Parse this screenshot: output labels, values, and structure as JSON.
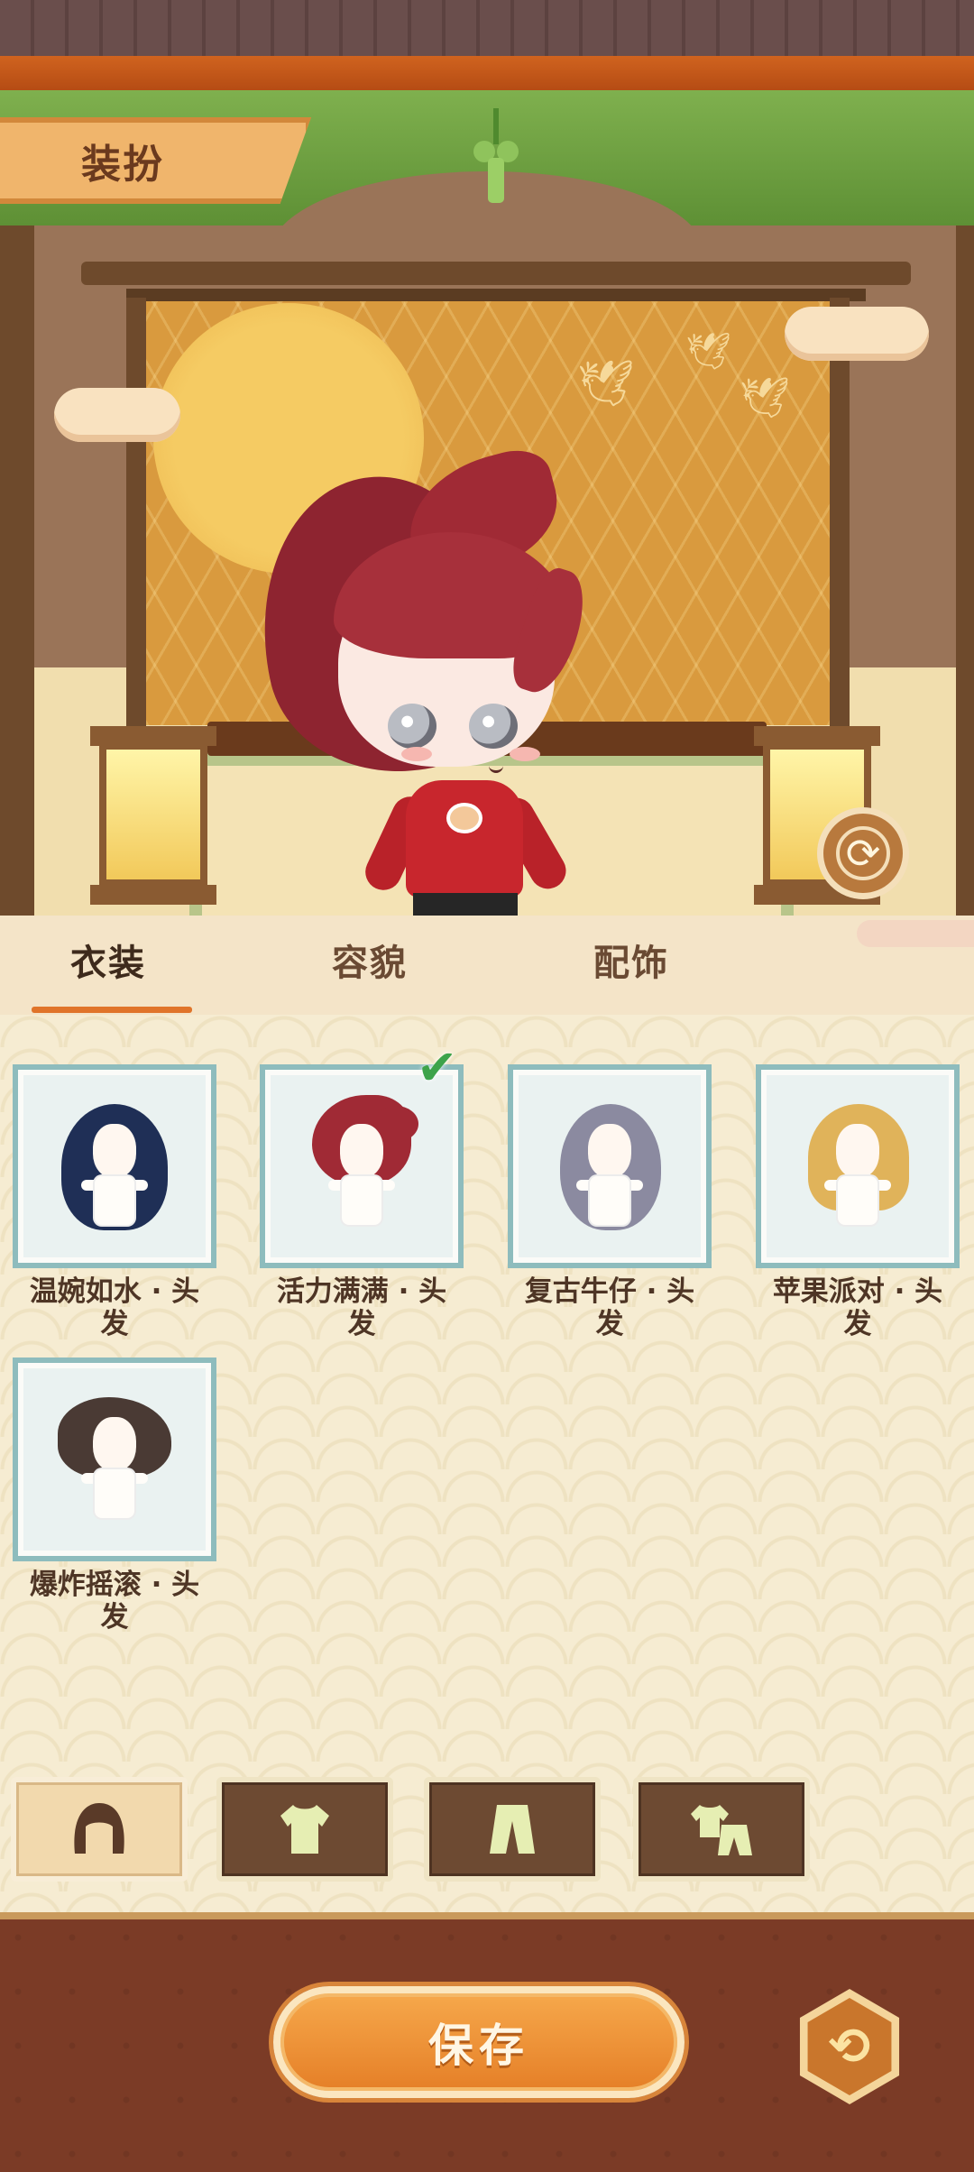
{
  "header": {
    "title": "装扮"
  },
  "tabs": [
    {
      "label": "衣装",
      "active": true
    },
    {
      "label": "容貌",
      "active": false
    },
    {
      "label": "配饰",
      "active": false
    }
  ],
  "items": [
    {
      "label": "温婉如水 · 头发",
      "hair_color": "#1f2f56",
      "selected": false
    },
    {
      "label": "活力满满 · 头发",
      "hair_color": "#a02a35",
      "selected": true
    },
    {
      "label": "复古牛仔 · 头发",
      "hair_color": "#8b8aa0",
      "selected": false
    },
    {
      "label": "苹果派对 · 头发",
      "hair_color": "#e0b35a",
      "selected": false
    },
    {
      "label": "爆炸摇滚 · 头发",
      "hair_color": "#4a3a34",
      "selected": false
    }
  ],
  "categories": [
    {
      "icon": "hair-icon",
      "active": true
    },
    {
      "icon": "shirt-icon",
      "active": false
    },
    {
      "icon": "pants-icon",
      "active": false
    },
    {
      "icon": "outfit-set-icon",
      "active": false
    }
  ],
  "footer": {
    "save_label": "保存"
  },
  "colors": {
    "accent": "#e57f27",
    "tab_underline": "#e0742a",
    "check": "#3da34a"
  }
}
